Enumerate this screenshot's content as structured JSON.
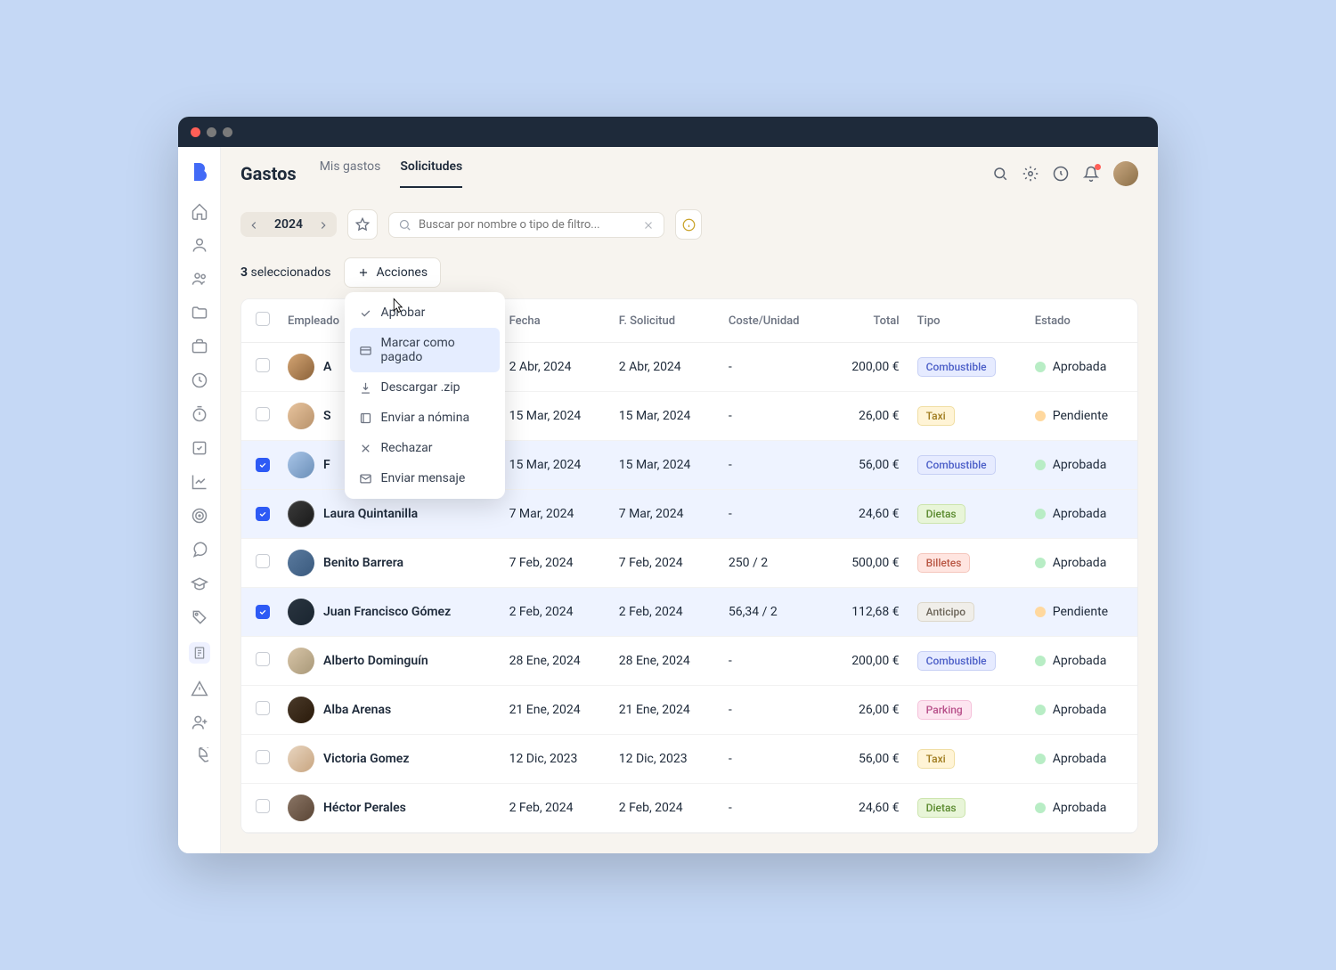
{
  "page_title": "Gastos",
  "tabs": [
    {
      "label": "Mis gastos",
      "active": false
    },
    {
      "label": "Solicitudes",
      "active": true
    }
  ],
  "year": "2024",
  "search_placeholder": "Buscar por nombre o tipo de filtro...",
  "selected_count": "3",
  "selected_label": "seleccionados",
  "actions_label": "Acciones",
  "actions_menu": [
    {
      "icon": "check",
      "label": "Aprobar",
      "hover": false
    },
    {
      "icon": "card",
      "label": "Marcar como pagado",
      "hover": true
    },
    {
      "icon": "download",
      "label": "Descargar .zip",
      "hover": false
    },
    {
      "icon": "send",
      "label": "Enviar a nómina",
      "hover": false
    },
    {
      "icon": "x",
      "label": "Rechazar",
      "hover": false
    },
    {
      "icon": "mail",
      "label": "Enviar mensaje",
      "hover": false
    }
  ],
  "columns": {
    "empleado": "Empleado",
    "fecha": "Fecha",
    "fsolicitud": "F. Solicitud",
    "coste": "Coste/Unidad",
    "total": "Total",
    "tipo": "Tipo",
    "estado": "Estado"
  },
  "status_labels": {
    "approved": "Aprobada",
    "pending": "Pendiente"
  },
  "type_labels": {
    "combustible": "Combustible",
    "taxi": "Taxi",
    "dietas": "Dietas",
    "billetes": "Billetes",
    "anticipo": "Anticipo",
    "parking": "Parking"
  },
  "rows": [
    {
      "sel": false,
      "av": "av1",
      "name": "A",
      "name_cut": true,
      "fecha": "2 Abr, 2024",
      "fsol": "2 Abr, 2024",
      "coste": "-",
      "total": "200,00 €",
      "tipo": "combustible",
      "estado": "approved"
    },
    {
      "sel": false,
      "av": "av2",
      "name": "S",
      "name_cut": true,
      "fecha": "15 Mar, 2024",
      "fsol": "15 Mar, 2024",
      "coste": "-",
      "total": "26,00 €",
      "tipo": "taxi",
      "estado": "pending"
    },
    {
      "sel": true,
      "av": "av3",
      "name": "F",
      "name_cut": true,
      "fecha": "15 Mar, 2024",
      "fsol": "15 Mar, 2024",
      "coste": "-",
      "total": "56,00 €",
      "tipo": "combustible",
      "estado": "approved"
    },
    {
      "sel": true,
      "av": "av4",
      "name": "Laura Quintanilla",
      "name_cut": false,
      "fecha": "7 Mar, 2024",
      "fsol": "7 Mar, 2024",
      "coste": "-",
      "total": "24,60 €",
      "tipo": "dietas",
      "estado": "approved"
    },
    {
      "sel": false,
      "av": "av5",
      "name": "Benito Barrera",
      "name_cut": false,
      "fecha": "7 Feb, 2024",
      "fsol": "7 Feb, 2024",
      "coste": "250 / 2",
      "total": "500,00 €",
      "tipo": "billetes",
      "estado": "approved"
    },
    {
      "sel": true,
      "av": "av6",
      "name": "Juan Francisco Gómez",
      "name_cut": false,
      "fecha": "2 Feb, 2024",
      "fsol": "2 Feb, 2024",
      "coste": "56,34 / 2",
      "total": "112,68 €",
      "tipo": "anticipo",
      "estado": "pending"
    },
    {
      "sel": false,
      "av": "av7",
      "name": "Alberto Dominguín",
      "name_cut": false,
      "fecha": "28 Ene, 2024",
      "fsol": "28 Ene, 2024",
      "coste": "-",
      "total": "200,00 €",
      "tipo": "combustible",
      "estado": "approved"
    },
    {
      "sel": false,
      "av": "av8",
      "name": "Alba Arenas",
      "name_cut": false,
      "fecha": "21 Ene, 2024",
      "fsol": "21 Ene, 2024",
      "coste": "-",
      "total": "26,00 €",
      "tipo": "parking",
      "estado": "approved"
    },
    {
      "sel": false,
      "av": "av9",
      "name": "Victoria Gomez",
      "name_cut": false,
      "fecha": "12 Dic, 2023",
      "fsol": "12 Dic, 2023",
      "coste": "-",
      "total": "56,00 €",
      "tipo": "taxi",
      "estado": "approved"
    },
    {
      "sel": false,
      "av": "av10",
      "name": "Héctor Perales",
      "name_cut": false,
      "fecha": "2 Feb, 2024",
      "fsol": "2 Feb, 2024",
      "coste": "-",
      "total": "24,60 €",
      "tipo": "dietas",
      "estado": "approved"
    }
  ],
  "sidebar_icons": [
    "home-icon",
    "user-icon",
    "users-icon",
    "folder-icon",
    "briefcase-icon",
    "clock-icon",
    "timer-icon",
    "check-square-icon",
    "chart-icon",
    "target-icon",
    "chat-icon",
    "mortarboard-icon",
    "tag-icon",
    "receipt-icon",
    "warning-icon",
    "user-plus-icon",
    "pie-icon"
  ]
}
